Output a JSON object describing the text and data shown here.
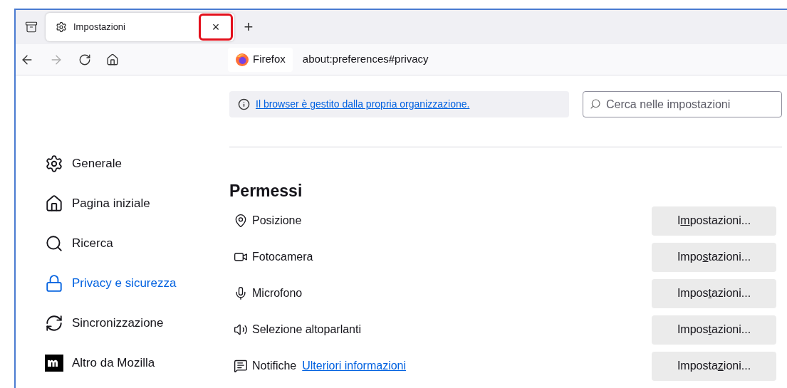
{
  "tab": {
    "title": "Impostazioni",
    "selected": true,
    "close": {
      "label": "×",
      "highlighted": true
    }
  },
  "new_tab": {
    "label": "+"
  },
  "url_bar": {
    "identity": "Firefox",
    "url": "about:preferences#privacy"
  },
  "notice": {
    "link": "Il browser è gestito dalla propria organizzazione."
  },
  "search": {
    "placeholder": "Cerca nelle impostazioni"
  },
  "sidebar": {
    "items": [
      {
        "label": "Generale",
        "selected": false
      },
      {
        "label": "Pagina iniziale",
        "selected": false
      },
      {
        "label": "Ricerca",
        "selected": false
      },
      {
        "label": "Privacy e sicurezza",
        "selected": true
      },
      {
        "label": "Sincronizzazione",
        "selected": false
      },
      {
        "label": "Altro da Mozilla",
        "selected": false
      }
    ]
  },
  "section": {
    "title": "Permessi",
    "rows": [
      {
        "label": "Posizione",
        "button": [
          "I",
          "m",
          "postazioni..."
        ]
      },
      {
        "label": "Fotocamera",
        "button": [
          "Impo",
          "s",
          "tazioni..."
        ]
      },
      {
        "label": "Microfono",
        "button": [
          "Impos",
          "t",
          "azioni..."
        ]
      },
      {
        "label": "Selezione altoparlanti",
        "button": [
          "Impos",
          "t",
          "azioni..."
        ]
      },
      {
        "label": "Notifiche",
        "link": "Ulteriori informazioni",
        "button": [
          "Imposta",
          "z",
          "ioni..."
        ]
      }
    ]
  }
}
